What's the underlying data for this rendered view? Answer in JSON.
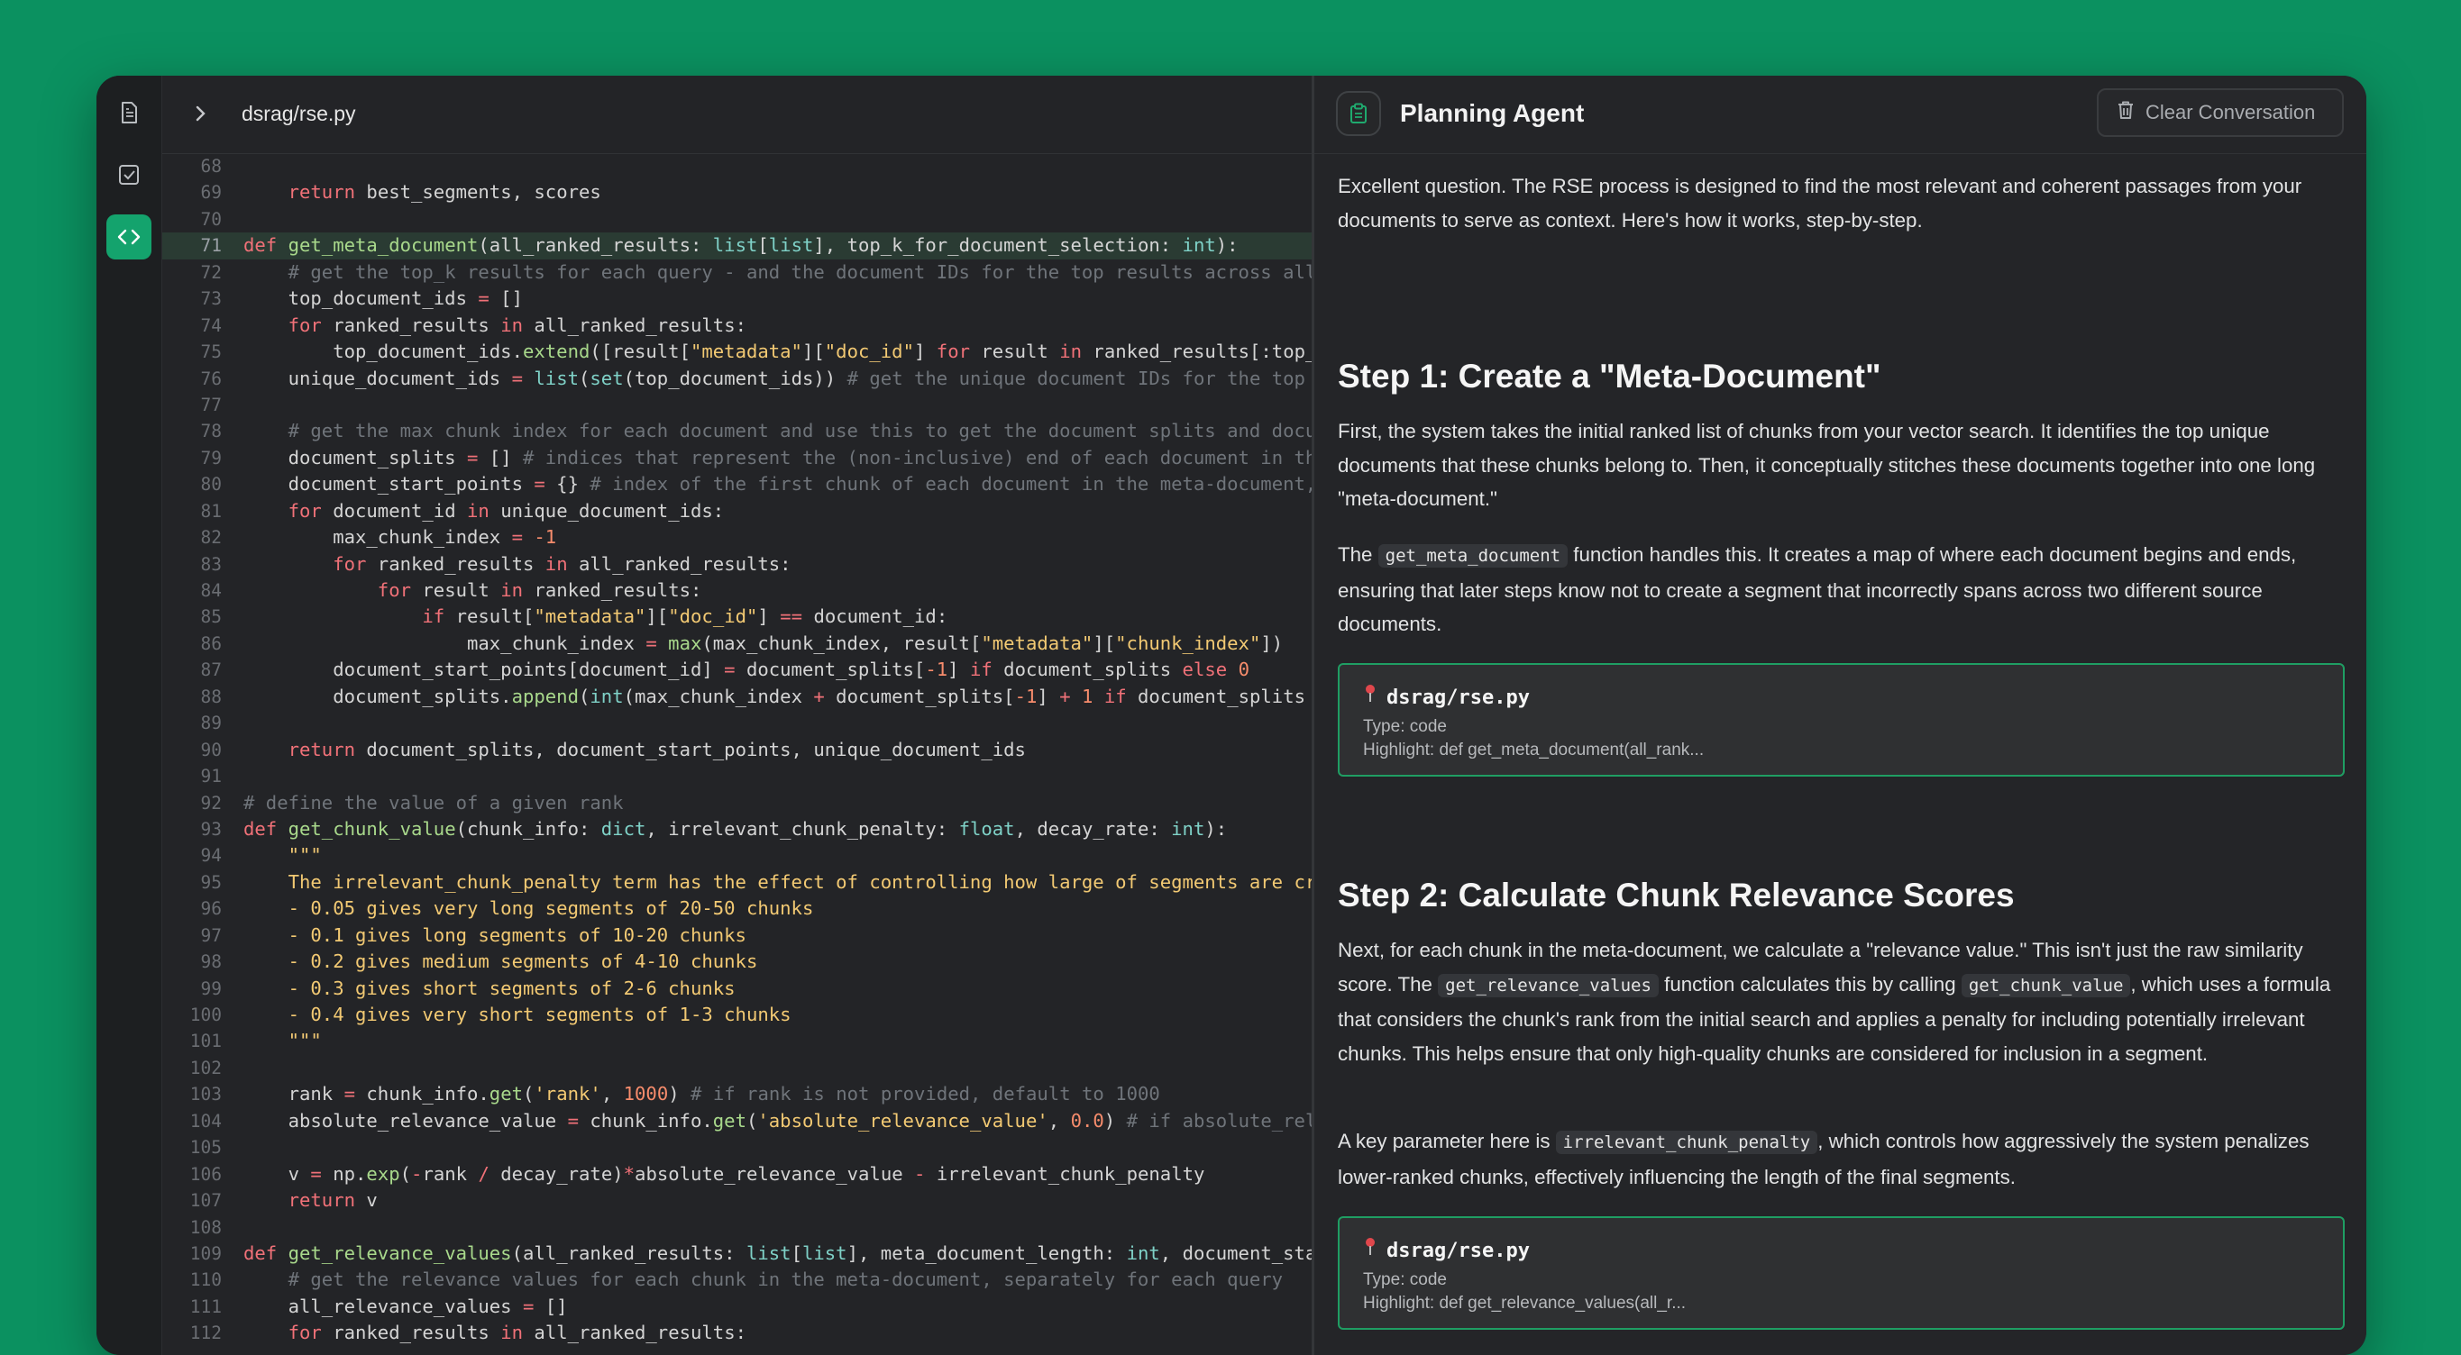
{
  "editor": {
    "filepath": "dsrag/rse.py",
    "highlighted_line": 71,
    "lines": [
      {
        "n": "68",
        "html": ""
      },
      {
        "n": "69",
        "html": "    <span class=\"kw\">return</span> best_segments, scores"
      },
      {
        "n": "70",
        "html": ""
      },
      {
        "n": "71",
        "html": "<span class=\"kw\">def</span> <span class=\"fn\">get_meta_document</span>(all_ranked_results: <span class=\"ty\">list</span>[<span class=\"ty\">list</span>], top_k_for_document_selection: <span class=\"ty\">int</span>):"
      },
      {
        "n": "72",
        "html": "    <span class=\"cm\"># get the top_k results for each query - and the document IDs for the top results across all q</span>"
      },
      {
        "n": "73",
        "html": "    top_document_ids <span class=\"op\">=</span> []"
      },
      {
        "n": "74",
        "html": "    <span class=\"kw\">for</span> ranked_results <span class=\"kw\">in</span> all_ranked_results:"
      },
      {
        "n": "75",
        "html": "        top_document_ids.<span class=\"fn\">extend</span>([result[<span class=\"str\">\"metadata\"</span>][<span class=\"str\">\"doc_id\"</span>] <span class=\"kw\">for</span> result <span class=\"kw\">in</span> ranked_results[:top_k_"
      },
      {
        "n": "76",
        "html": "    unique_document_ids <span class=\"op\">=</span> <span class=\"ty\">list</span>(<span class=\"ty\">set</span>(top_document_ids)) <span class=\"cm\"># get the unique document IDs for the top re</span>"
      },
      {
        "n": "77",
        "html": ""
      },
      {
        "n": "78",
        "html": "    <span class=\"cm\"># get the max chunk index for each document and use this to get the document splits and docume</span>"
      },
      {
        "n": "79",
        "html": "    document_splits <span class=\"op\">=</span> [] <span class=\"cm\"># indices that represent the (non-inclusive) end of each document in the</span>"
      },
      {
        "n": "80",
        "html": "    document_start_points <span class=\"op\">=</span> {} <span class=\"cm\"># index of the first chunk of each document in the meta-document, k</span>"
      },
      {
        "n": "81",
        "html": "    <span class=\"kw\">for</span> document_id <span class=\"kw\">in</span> unique_document_ids:"
      },
      {
        "n": "82",
        "html": "        max_chunk_index <span class=\"op\">=</span> <span class=\"num\">-1</span>"
      },
      {
        "n": "83",
        "html": "        <span class=\"kw\">for</span> ranked_results <span class=\"kw\">in</span> all_ranked_results:"
      },
      {
        "n": "84",
        "html": "            <span class=\"kw\">for</span> result <span class=\"kw\">in</span> ranked_results:"
      },
      {
        "n": "85",
        "html": "                <span class=\"kw\">if</span> result[<span class=\"str\">\"metadata\"</span>][<span class=\"str\">\"doc_id\"</span>] <span class=\"op\">==</span> document_id:"
      },
      {
        "n": "86",
        "html": "                    max_chunk_index <span class=\"op\">=</span> <span class=\"fn\">max</span>(max_chunk_index, result[<span class=\"str\">\"metadata\"</span>][<span class=\"str\">\"chunk_index\"</span>])"
      },
      {
        "n": "87",
        "html": "        document_start_points[document_id] <span class=\"op\">=</span> document_splits[<span class=\"num\">-1</span>] <span class=\"kw\">if</span> document_splits <span class=\"kw\">else</span> <span class=\"num\">0</span>"
      },
      {
        "n": "88",
        "html": "        document_splits.<span class=\"fn\">append</span>(<span class=\"ty\">int</span>(max_chunk_index <span class=\"op\">+</span> document_splits[<span class=\"num\">-1</span>] <span class=\"op\">+</span> <span class=\"num\">1</span> <span class=\"kw\">if</span> document_splits <span class=\"kw\">e</span>"
      },
      {
        "n": "89",
        "html": ""
      },
      {
        "n": "90",
        "html": "    <span class=\"kw\">return</span> document_splits, document_start_points, unique_document_ids"
      },
      {
        "n": "91",
        "html": ""
      },
      {
        "n": "92",
        "html": "<span class=\"cm\"># define the value of a given rank</span>"
      },
      {
        "n": "93",
        "html": "<span class=\"kw\">def</span> <span class=\"fn\">get_chunk_value</span>(chunk_info: <span class=\"ty\">dict</span>, irrelevant_chunk_penalty: <span class=\"ty\">float</span>, decay_rate: <span class=\"ty\">int</span>):"
      },
      {
        "n": "94",
        "html": "    <span class=\"str\">\"\"\"</span>"
      },
      {
        "n": "95",
        "html": "    <span class=\"str\">The irrelevant_chunk_penalty term has the effect of controlling how large of segments are crea</span>"
      },
      {
        "n": "96",
        "html": "    <span class=\"str\">- 0.05 gives very long segments of 20-50 chunks</span>"
      },
      {
        "n": "97",
        "html": "    <span class=\"str\">- 0.1 gives long segments of 10-20 chunks</span>"
      },
      {
        "n": "98",
        "html": "    <span class=\"str\">- 0.2 gives medium segments of 4-10 chunks</span>"
      },
      {
        "n": "99",
        "html": "    <span class=\"str\">- 0.3 gives short segments of 2-6 chunks</span>"
      },
      {
        "n": "100",
        "html": "    <span class=\"str\">- 0.4 gives very short segments of 1-3 chunks</span>"
      },
      {
        "n": "101",
        "html": "    <span class=\"str\">\"\"\"</span>"
      },
      {
        "n": "102",
        "html": ""
      },
      {
        "n": "103",
        "html": "    rank <span class=\"op\">=</span> chunk_info.<span class=\"fn\">get</span>(<span class=\"str\">'rank'</span>, <span class=\"num\">1000</span>) <span class=\"cm\"># if rank is not provided, default to 1000</span>"
      },
      {
        "n": "104",
        "html": "    absolute_relevance_value <span class=\"op\">=</span> chunk_info.<span class=\"fn\">get</span>(<span class=\"str\">'absolute_relevance_value'</span>, <span class=\"num\">0.0</span>) <span class=\"cm\"># if absolute_relev</span>"
      },
      {
        "n": "105",
        "html": ""
      },
      {
        "n": "106",
        "html": "    v <span class=\"op\">=</span> np.<span class=\"fn\">exp</span>(<span class=\"op\">-</span>rank <span class=\"op\">/</span> decay_rate)<span class=\"op\">*</span>absolute_relevance_value <span class=\"op\">-</span> irrelevant_chunk_penalty"
      },
      {
        "n": "107",
        "html": "    <span class=\"kw\">return</span> v"
      },
      {
        "n": "108",
        "html": ""
      },
      {
        "n": "109",
        "html": "<span class=\"kw\">def</span> <span class=\"fn\">get_relevance_values</span>(all_ranked_results: <span class=\"ty\">list</span>[<span class=\"ty\">list</span>], meta_document_length: <span class=\"ty\">int</span>, document_start"
      },
      {
        "n": "110",
        "html": "    <span class=\"cm\"># get the relevance values for each chunk in the meta-document, separately for each query</span>"
      },
      {
        "n": "111",
        "html": "    all_relevance_values <span class=\"op\">=</span> []"
      },
      {
        "n": "112",
        "html": "    <span class=\"kw\">for</span> ranked_results <span class=\"kw\">in</span> all_ranked_results:"
      }
    ]
  },
  "chat": {
    "title": "Planning Agent",
    "clear_label": "Clear Conversation",
    "intro": "Excellent question. The RSE process is designed to find the most relevant and coherent passages from your documents to serve as context. Here's how it works, step-by-step.",
    "step1": {
      "heading": "Step 1: Create a \"Meta-Document\"",
      "p1": "First, the system takes the initial ranked list of chunks from your vector search. It identifies the top unique documents that these chunks belong to. Then, it conceptually stitches these documents together into one long \"meta-document.\"",
      "p2_before": "The",
      "p2_code": "get_meta_document",
      "p2_after": "function handles this. It creates a map of where each document begins and ends, ensuring that later steps know not to create a segment that incorrectly spans across two different source documents.",
      "ref": {
        "icon": "pin-icon",
        "file": "dsrag/rse.py",
        "type": "Type: code",
        "highlight": "Highlight: def get_meta_document(all_rank..."
      }
    },
    "step2": {
      "heading": "Step 2: Calculate Chunk Relevance Scores",
      "p1_a": "Next, for each chunk in the meta-document, we calculate a \"relevance value.\" This isn't just the raw similarity score. The",
      "p1_code1": "get_relevance_values",
      "p1_b": "function calculates this by calling",
      "p1_code2": "get_chunk_value",
      "p1_c": ", which uses a formula that considers the chunk's rank from the initial search and applies a penalty for including potentially irrelevant chunks. This helps ensure that only high-quality chunks are considered for inclusion in a segment.",
      "p2_a": "A key parameter here is",
      "p2_code": "irrelevant_chunk_penalty",
      "p2_b": ", which controls how aggressively the system penalizes lower-ranked chunks, effectively influencing the length of the final segments.",
      "ref": {
        "icon": "pin-icon",
        "file": "dsrag/rse.py",
        "type": "Type: code",
        "highlight": "Highlight: def get_relevance_values(all_r..."
      }
    }
  },
  "colors": {
    "background": "#0b9160",
    "accent": "#14a36d",
    "card_border": "#1f9e63"
  }
}
